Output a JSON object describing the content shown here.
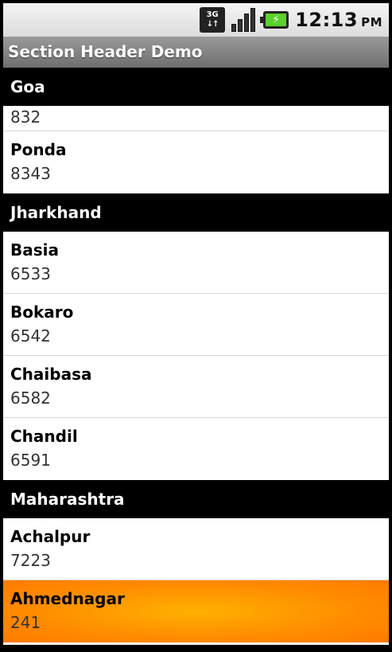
{
  "status_bar": {
    "network": "3G",
    "time": "12:13",
    "ampm": "PM"
  },
  "app": {
    "title": "Section Header Demo"
  },
  "sections": [
    {
      "header": "Goa",
      "items": [
        {
          "name": "",
          "code": "832",
          "partial": true
        },
        {
          "name": "Ponda",
          "code": "8343"
        }
      ]
    },
    {
      "header": "Jharkhand",
      "items": [
        {
          "name": "Basia",
          "code": "6533"
        },
        {
          "name": "Bokaro",
          "code": "6542"
        },
        {
          "name": "Chaibasa",
          "code": "6582"
        },
        {
          "name": "Chandil",
          "code": "6591"
        }
      ]
    },
    {
      "header": "Maharashtra",
      "items": [
        {
          "name": "Achalpur",
          "code": "7223"
        },
        {
          "name": "Ahmednagar",
          "code": "241",
          "selected": true
        }
      ]
    }
  ],
  "colors": {
    "selection": "#ff8c00",
    "header_bg": "#000000"
  }
}
